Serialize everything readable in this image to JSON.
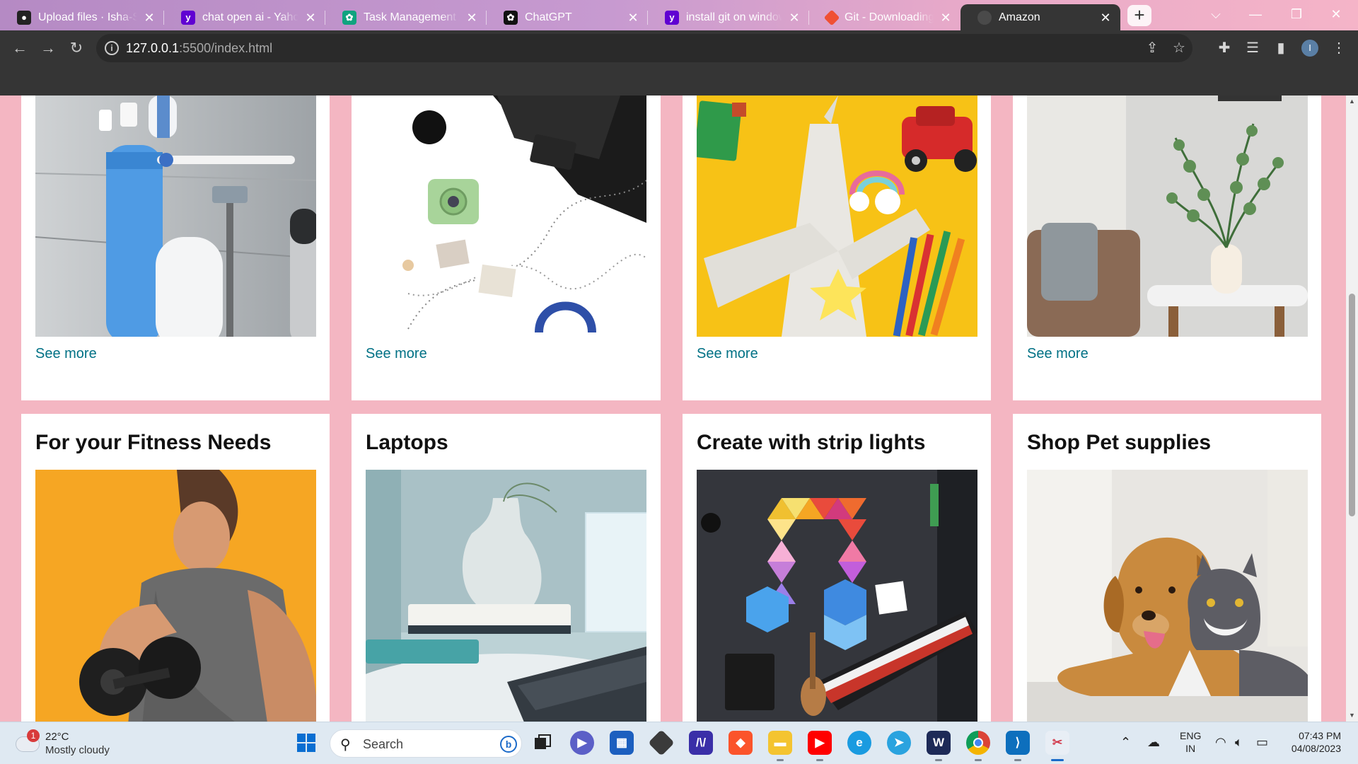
{
  "browser": {
    "tabs": [
      {
        "title": "Upload files · Isha-Soc",
        "favicon": "github-icon",
        "color": "#222222"
      },
      {
        "title": "chat open ai - Yahoo",
        "favicon": "yahoo-icon",
        "color": "#6001d2"
      },
      {
        "title": "Task Management Ap",
        "favicon": "openai-icon",
        "color": "#10a37f"
      },
      {
        "title": "ChatGPT",
        "favicon": "openai-icon",
        "color": "#111111"
      },
      {
        "title": "install git on windows",
        "favicon": "yahoo-icon",
        "color": "#6001d2"
      },
      {
        "title": "Git - Downloading Pa",
        "favicon": "git-icon",
        "color": "#f05033"
      },
      {
        "title": "Amazon",
        "favicon": "globe-icon",
        "color": "#888888"
      }
    ],
    "active_tab": 6,
    "url_host": "127.0.0.1",
    "url_path": ":5500/index.html",
    "profile_initial": "I"
  },
  "page": {
    "top_cards": [
      {
        "link": "See more",
        "image": "personal-care-image"
      },
      {
        "link": "See more",
        "image": "laptop-desk-image"
      },
      {
        "link": "See more",
        "image": "toys-image"
      },
      {
        "link": "See more",
        "image": "home-decor-image"
      }
    ],
    "bottom_cards": [
      {
        "title": "For your Fitness Needs",
        "image": "fitness-image"
      },
      {
        "title": "Laptops",
        "image": "laptops-image"
      },
      {
        "title": "Create with strip lights",
        "image": "strip-lights-image"
      },
      {
        "title": "Shop Pet supplies",
        "image": "pet-supplies-image"
      }
    ],
    "link_color": "#007185",
    "background_color": "#f4b6c2"
  },
  "taskbar": {
    "weather_temp": "22°C",
    "weather_desc": "Mostly cloudy",
    "weather_badge": "1",
    "search_label": "Search",
    "lang_line1": "ENG",
    "lang_line2": "IN",
    "time": "07:43 PM",
    "date": "04/08/2023"
  }
}
